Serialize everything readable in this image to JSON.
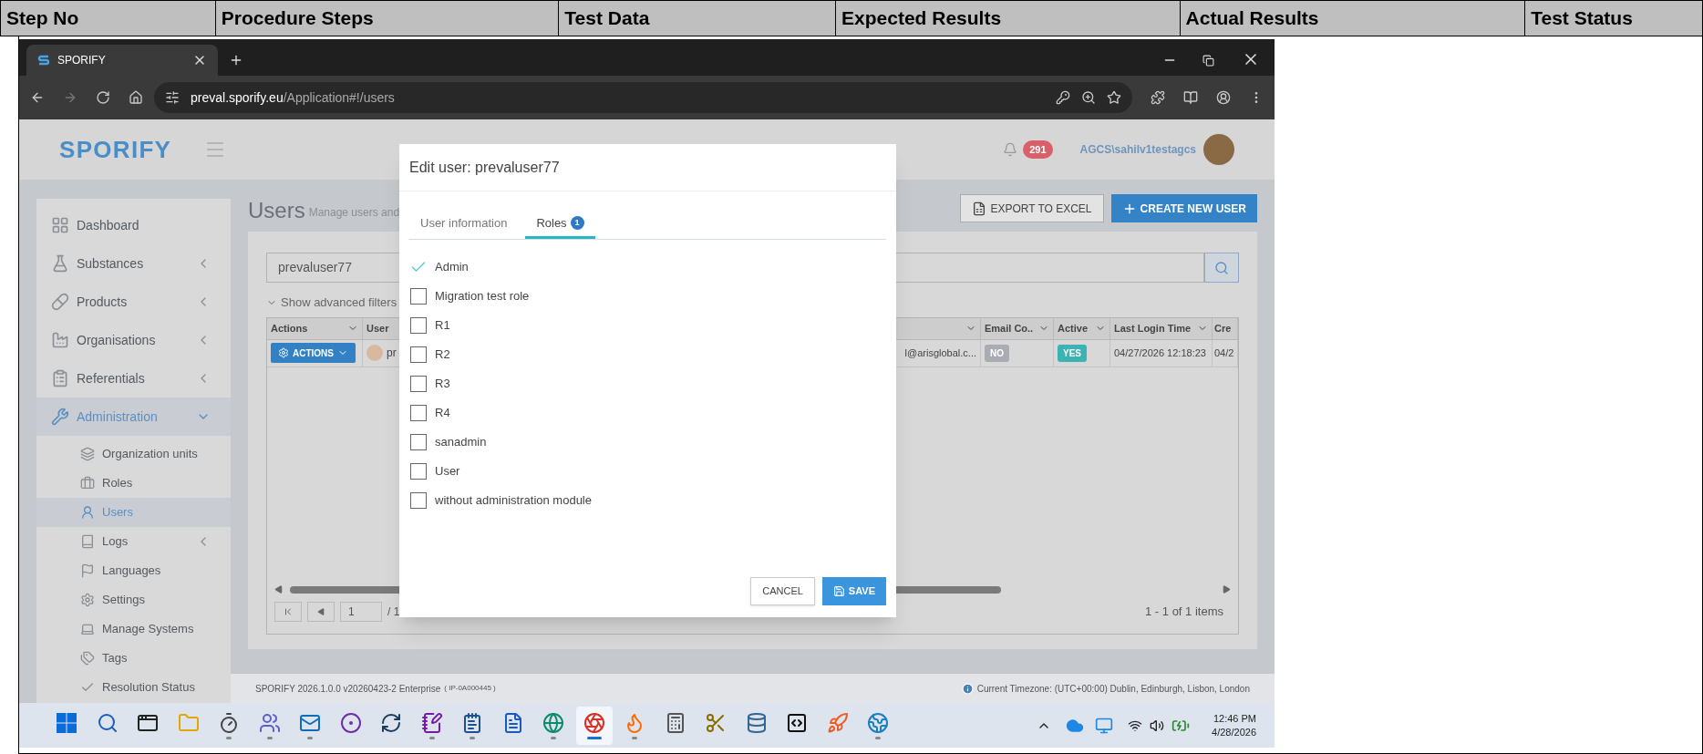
{
  "doc_table": {
    "columns": [
      "Step No",
      "Procedure Steps",
      "Test Data",
      "Expected Results",
      "Actual Results",
      "Test Status"
    ]
  },
  "browser": {
    "tab_title": "SPORIFY",
    "url_host": "preval.sporify.eu",
    "url_path": "/Application#!/users"
  },
  "app": {
    "logo": "SPORIFY",
    "notifications": "291",
    "user": "AGCS\\sahilv1testagcs"
  },
  "sidebar": {
    "items": [
      {
        "label": "Dashboard",
        "kind": "link",
        "selected": false
      },
      {
        "label": "Substances",
        "kind": "group",
        "expanded": false,
        "selected": false
      },
      {
        "label": "Products",
        "kind": "group",
        "expanded": false,
        "selected": false
      },
      {
        "label": "Organisations",
        "kind": "group",
        "expanded": false,
        "selected": false
      },
      {
        "label": "Referentials",
        "kind": "group",
        "expanded": false,
        "selected": false
      },
      {
        "label": "Administration",
        "kind": "group",
        "expanded": true,
        "selected": true,
        "children": [
          {
            "label": "Organization units",
            "kind": "link",
            "selected": false
          },
          {
            "label": "Roles",
            "kind": "link",
            "selected": false
          },
          {
            "label": "Users",
            "kind": "link",
            "selected": true
          },
          {
            "label": "Logs",
            "kind": "group",
            "expanded": false,
            "selected": false
          },
          {
            "label": "Languages",
            "kind": "link",
            "selected": false
          },
          {
            "label": "Settings",
            "kind": "link",
            "selected": false
          },
          {
            "label": "Manage Systems",
            "kind": "link",
            "selected": false
          },
          {
            "label": "Tags",
            "kind": "link",
            "selected": false
          },
          {
            "label": "Resolution Status",
            "kind": "link",
            "selected": false
          }
        ]
      }
    ]
  },
  "page": {
    "title": "Users",
    "subtitle": "Manage users and",
    "buttons": [
      {
        "label": "EXPORT TO EXCEL",
        "kind": "secondary"
      },
      {
        "label": "CREATE NEW USER",
        "kind": "primary"
      }
    ],
    "search": {
      "value": "prevaluser77"
    },
    "filters_toggle": "Show advanced filters",
    "grid": {
      "columns": [
        {
          "label": "Actions",
          "menu": true
        },
        {
          "label": "User",
          "menu": false
        },
        {
          "menu": true
        },
        {
          "label": "Email Co..",
          "menu": true
        },
        {
          "label": "Active",
          "menu": true
        },
        {
          "label": "Last Login Time",
          "menu": true
        },
        {
          "label": "Cre",
          "menu": false
        }
      ],
      "rows": [
        {
          "cells": [
            {
              "kind": "actions",
              "text": "ACTIONS"
            },
            {
              "kind": "user",
              "text": "pr"
            },
            {
              "kind": "text_end",
              "text": "l@arisglobal.c..."
            },
            {
              "kind": "badge",
              "text": "NO",
              "color": "#a9adb3"
            },
            {
              "kind": "badge",
              "text": "YES",
              "color": "#3bb3b5"
            },
            {
              "kind": "text",
              "text": "04/27/2026 12:18:23"
            },
            {
              "kind": "text",
              "text": "04/2"
            }
          ]
        }
      ]
    },
    "pager": {
      "page": "1",
      "of": "/ 1",
      "summary": "1 - 1 of 1 items"
    }
  },
  "footer": {
    "version": "SPORIFY 2026.1.0.0 v20260423-2 Enterprise",
    "ip": "( IP-0A000445 )",
    "timezone": "Current Timezone: (UTC+00:00) Dublin, Edinburgh, Lisbon, London"
  },
  "modal": {
    "title": "Edit user: prevaluser77",
    "tabs": [
      {
        "label": "User information",
        "selected": false
      },
      {
        "label": "Roles",
        "selected": true,
        "badge": "1"
      }
    ],
    "roles": [
      {
        "label": "Admin",
        "checked": true
      },
      {
        "label": "Migration test role",
        "checked": false
      },
      {
        "label": "R1",
        "checked": false
      },
      {
        "label": "R2",
        "checked": false
      },
      {
        "label": "R3",
        "checked": false
      },
      {
        "label": "R4",
        "checked": false
      },
      {
        "label": "sanadmin",
        "checked": false
      },
      {
        "label": "User",
        "checked": false
      },
      {
        "label": "without administration module",
        "checked": false
      }
    ],
    "buttons": [
      {
        "label": "CANCEL",
        "kind": "secondary"
      },
      {
        "label": "SAVE",
        "kind": "primary"
      }
    ]
  },
  "taskbar": {
    "apps": [
      {
        "running": false,
        "selected": false
      },
      {
        "running": false,
        "selected": false
      },
      {
        "running": false,
        "selected": false
      },
      {
        "running": false,
        "selected": false
      },
      {
        "running": true,
        "selected": false
      },
      {
        "running": true,
        "selected": false
      },
      {
        "running": true,
        "selected": false
      },
      {
        "running": false,
        "selected": false
      },
      {
        "running": false,
        "selected": false
      },
      {
        "running": true,
        "selected": false
      },
      {
        "running": true,
        "selected": false
      },
      {
        "running": false,
        "selected": false
      },
      {
        "running": true,
        "selected": false
      },
      {
        "running": true,
        "selected": true
      },
      {
        "running": true,
        "selected": false
      },
      {
        "running": false,
        "selected": false
      },
      {
        "running": false,
        "selected": false
      },
      {
        "running": false,
        "selected": false
      },
      {
        "running": false,
        "selected": false
      },
      {
        "running": false,
        "selected": false
      },
      {
        "running": true,
        "selected": false
      }
    ],
    "time": "12:46 PM",
    "date": "4/28/2026"
  }
}
